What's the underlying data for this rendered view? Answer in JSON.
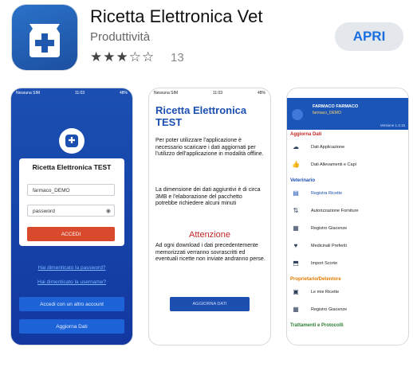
{
  "app": {
    "title": "Ricetta Elettronica Vet",
    "category": "Produttività",
    "stars": "★★★☆☆",
    "rating_count": "13",
    "open_label": "APRI",
    "icon": "medical-cross-icon"
  },
  "screenshot1": {
    "status_left": "Nessuna SIM",
    "status_center": "11:03",
    "status_right": "48%",
    "login_title": "Ricetta Elettronica TEST",
    "username_value": "farmaco_DEMO",
    "password_placeholder": "password",
    "login_button": "ACCEDI",
    "forgot_password": "Hai dimenticato la password?",
    "forgot_username": "Hai dimenticato la username?",
    "other_account_button": "Accedi con un altro account",
    "update_button": "Aggiorna Dati"
  },
  "screenshot2": {
    "status_left": "Nessuna SIM",
    "status_center": "11:03",
    "status_right": "48%",
    "title": "Ricetta Elettronica TEST",
    "paragraph1": "Per poter utilizzare l'applicazione è necessario scaricare i dati aggiornati per l'utilizzo dell'applicazione in modalità offline.",
    "paragraph2": "La dimensione dei dati aggiuntivi è di circa 3MB e l'elaborazione del pacchetto potrebbe richiedere alcuni minuti",
    "attention": "Attenzione",
    "paragraph3": "Ad ogni download i dati precedentemente memorizzati verranno sovrascritti ed eventuali ricette non inviate andranno perse.",
    "update_button": "AGGIORNA DATI"
  },
  "screenshot3": {
    "user_name": "FARMACO FARMACO",
    "user_sub": "farmaco_DEMO",
    "version": "Versione 1.3.15",
    "sections": [
      {
        "title": "Aggiorna Dati",
        "color": "#c62828",
        "items": [
          {
            "label": "Dati Applicazione",
            "icon": "cloud-icon",
            "blue": false
          },
          {
            "label": "Dati Allevamenti e Capi",
            "icon": "thumb-icon",
            "blue": false
          }
        ]
      },
      {
        "title": "Veterinario",
        "color": "#1b4fb1",
        "items": [
          {
            "label": "Registra Ricette",
            "icon": "document-icon",
            "blue": true
          },
          {
            "label": "Autorizzazione Forniture",
            "icon": "transfer-icon",
            "blue": false
          },
          {
            "label": "Registro Giacenze",
            "icon": "register-icon",
            "blue": false
          },
          {
            "label": "Medicinali Preferiti",
            "icon": "heart-icon",
            "blue": false
          },
          {
            "label": "Import Scorte",
            "icon": "import-icon",
            "blue": false
          }
        ]
      },
      {
        "title": "Proprietario/Detentore",
        "color": "#e07b00",
        "items": [
          {
            "label": "Le mie Ricette",
            "icon": "prescription-icon",
            "blue": false
          },
          {
            "label": "Registro Giacenze",
            "icon": "register-icon",
            "blue": false
          }
        ]
      },
      {
        "title": "Trattamenti e Protocolli",
        "color": "#2e7d32",
        "items": []
      }
    ]
  }
}
